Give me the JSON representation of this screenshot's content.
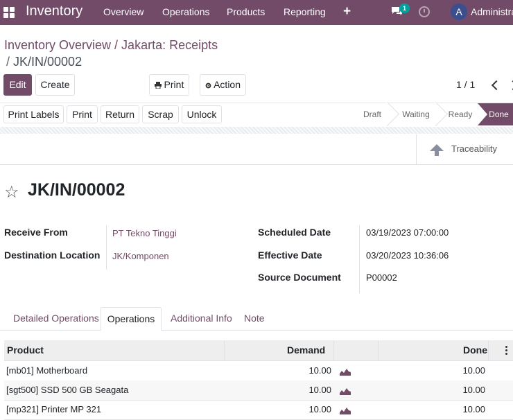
{
  "topbar": {
    "app_name": "Inventory",
    "menu": [
      "Overview",
      "Operations",
      "Products",
      "Reporting"
    ],
    "plus": "+",
    "chat_badge": "1",
    "avatar_letter": "A",
    "user_name": "Administrator"
  },
  "breadcrumb": {
    "path": "Inventory Overview / Jakarta: Receipts",
    "current": "JK/IN/00002",
    "sep": "/ "
  },
  "control": {
    "edit": "Edit",
    "create": "Create",
    "print": "Print",
    "action": "Action",
    "pager": "1 / 1"
  },
  "status_buttons": [
    "Print Labels",
    "Print",
    "Return",
    "Scrap",
    "Unlock"
  ],
  "stages": [
    "Draft",
    "Waiting",
    "Ready",
    "Done"
  ],
  "current_stage": "Done",
  "smart_button": {
    "label": "Traceability"
  },
  "record": {
    "title": "JK/IN/00002",
    "fields_left": [
      {
        "label": "Receive From",
        "value": "PT Tekno Tinggi"
      },
      {
        "label": "Destination Location",
        "value": "JK/Komponen"
      }
    ],
    "fields_right": [
      {
        "label": "Scheduled Date",
        "value": "03/19/2023 07:00:00"
      },
      {
        "label": "Effective Date",
        "value": "03/20/2023 10:36:06"
      },
      {
        "label": "Source Document",
        "value": "P00002"
      }
    ]
  },
  "tabs": [
    "Detailed Operations",
    "Operations",
    "Additional Info",
    "Note"
  ],
  "active_tab": "Operations",
  "table": {
    "headers": {
      "product": "Product",
      "demand": "Demand",
      "done": "Done"
    },
    "rows": [
      {
        "product": "[mb01] Motherboard",
        "demand": "10.00",
        "done": "10.00"
      },
      {
        "product": "[sgt500] SSD 500 GB Seagata",
        "demand": "10.00",
        "done": "10.00"
      },
      {
        "product": "[mp321] Printer MP 321",
        "demand": "10.00",
        "done": "10.00"
      }
    ]
  },
  "colors": {
    "brand": "#714B67",
    "badge": "#00A09D",
    "avatar": "#3b4f8f"
  },
  "icons": [
    "apps-icon",
    "plus-icon",
    "chat-icon",
    "clock-icon",
    "printer-icon",
    "gear-icon",
    "chevron-left-icon",
    "chevron-right-icon",
    "arrow-up-icon",
    "star-icon",
    "forecast-icon",
    "kebab-icon"
  ]
}
